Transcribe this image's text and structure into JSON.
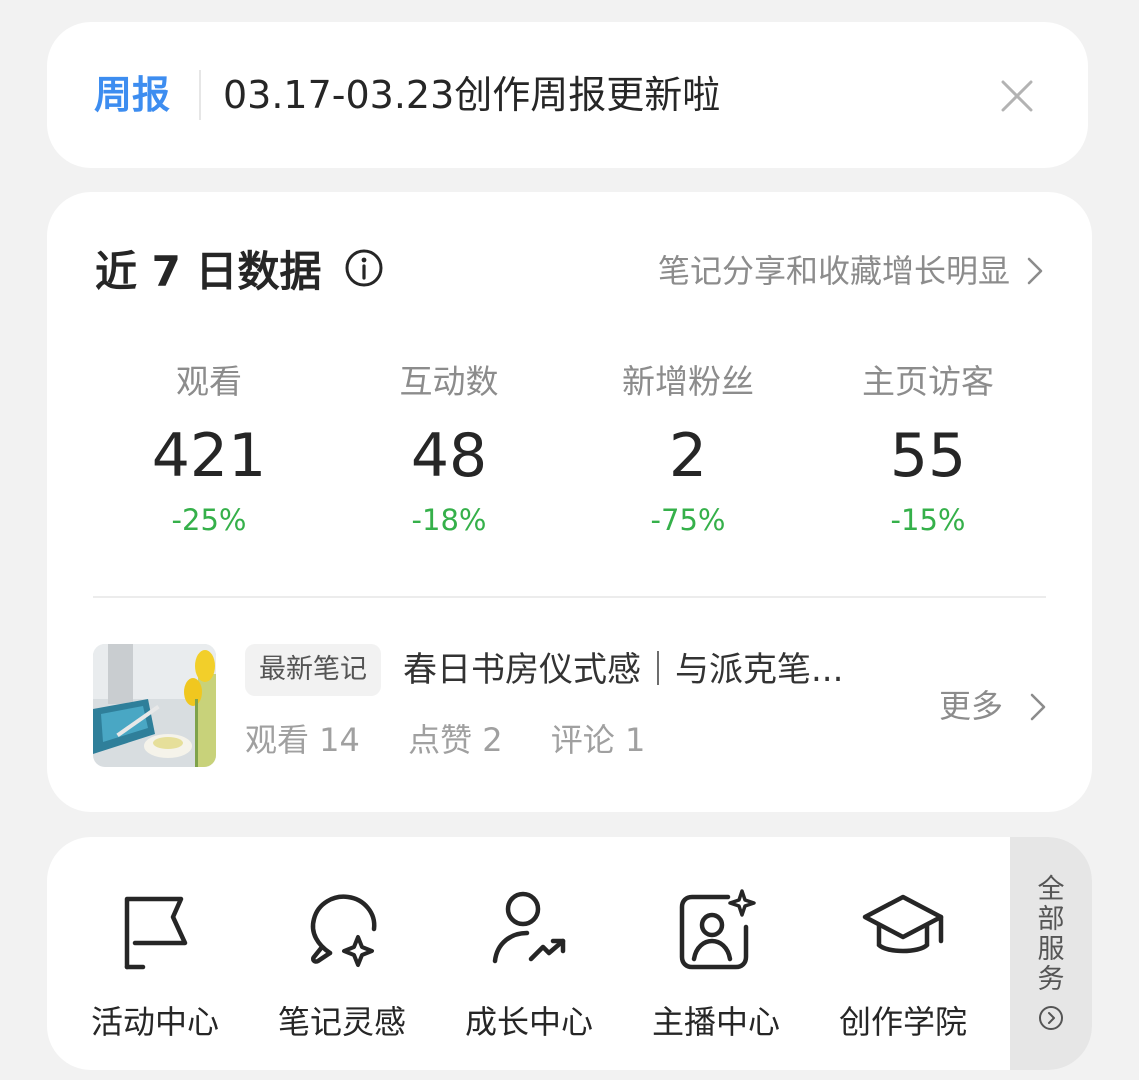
{
  "report": {
    "tag": "周报",
    "text": "03.17-03.23创作周报更新啦"
  },
  "data_card": {
    "title": "近 7 日数据",
    "hint": "笔记分享和收藏增长明显",
    "stats": [
      {
        "label": "观看",
        "value": "421",
        "delta": "-25%"
      },
      {
        "label": "互动数",
        "value": "48",
        "delta": "-18%"
      },
      {
        "label": "新增粉丝",
        "value": "2",
        "delta": "-75%"
      },
      {
        "label": "主页访客",
        "value": "55",
        "delta": "-15%"
      }
    ],
    "latest_note": {
      "tag": "最新笔记",
      "title": "春日书房仪式感｜与派克笔...",
      "views": "观看 14",
      "likes": "点赞 2",
      "comments": "评论 1",
      "more": "更多"
    }
  },
  "services": {
    "items": [
      {
        "label": "活动中心",
        "icon": "flag-icon"
      },
      {
        "label": "笔记灵感",
        "icon": "lightbulb-sparkle-icon"
      },
      {
        "label": "成长中心",
        "icon": "user-growth-icon"
      },
      {
        "label": "主播中心",
        "icon": "anchor-portrait-icon"
      },
      {
        "label": "创作学院",
        "icon": "graduation-cap-icon"
      }
    ],
    "all_label": "全部服务"
  },
  "colors": {
    "accent": "#3d8df0",
    "positive_delta": "#35b04a",
    "background": "#f2f2f2"
  }
}
